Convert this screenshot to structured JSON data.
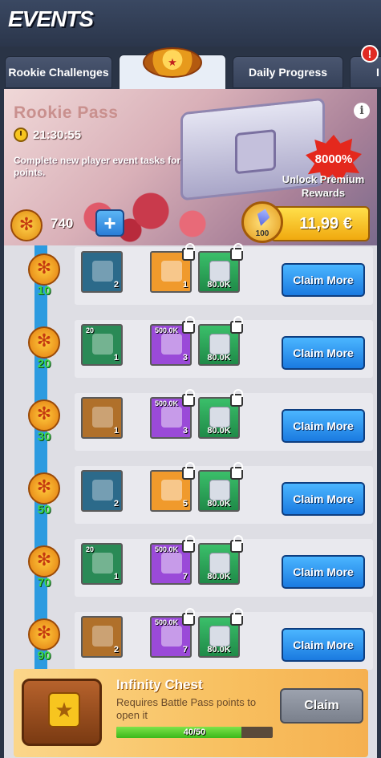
{
  "header": {
    "title": "EVENTS",
    "alert_badge": "!"
  },
  "tabs": [
    {
      "label": "Rookie Challenges",
      "active": false
    },
    {
      "label": "",
      "active": true,
      "logo": "event-logo-icon"
    },
    {
      "label": "Daily Progress",
      "active": false
    },
    {
      "label": "I",
      "active": false
    }
  ],
  "pass": {
    "title": "Rookie Pass",
    "timer": "21:30:55",
    "description": "Complete new player event tasks for points.",
    "info": "i",
    "bonus_badge": "8000%",
    "unlock_label": "Unlock Premium Rewards",
    "points": "740",
    "plus_label": "+",
    "gem_count": "100",
    "price": "11,99 €"
  },
  "rows": [
    {
      "level": "10",
      "free_item": {
        "color": "#2c6a8a",
        "qty": "2",
        "top": ""
      },
      "premium_item": {
        "color": "#f09a2c",
        "qty": "1",
        "top": ""
      },
      "xp_item": {
        "label": "80.0K"
      },
      "button": "Claim More"
    },
    {
      "level": "20",
      "free_item": {
        "color": "#2a8a56",
        "qty": "1",
        "top": "20"
      },
      "premium_item": {
        "color": "#9a4ad8",
        "qty": "3",
        "top": "500.0K"
      },
      "xp_item": {
        "label": "80.0K"
      },
      "button": "Claim More"
    },
    {
      "level": "30",
      "free_item": {
        "color": "#b0702a",
        "qty": "1",
        "top": ""
      },
      "premium_item": {
        "color": "#9a4ad8",
        "qty": "3",
        "top": "500.0K"
      },
      "xp_item": {
        "label": "80.0K"
      },
      "button": "Claim More"
    },
    {
      "level": "50",
      "free_item": {
        "color": "#2c6a8a",
        "qty": "2",
        "top": ""
      },
      "premium_item": {
        "color": "#f09a2c",
        "qty": "5",
        "top": ""
      },
      "xp_item": {
        "label": "80.0K"
      },
      "button": "Claim More"
    },
    {
      "level": "70",
      "free_item": {
        "color": "#2a8a56",
        "qty": "1",
        "top": "20"
      },
      "premium_item": {
        "color": "#9a4ad8",
        "qty": "7",
        "top": "500.0K"
      },
      "xp_item": {
        "label": "80.0K"
      },
      "button": "Claim More"
    },
    {
      "level": "90",
      "free_item": {
        "color": "#b0702a",
        "qty": "2",
        "top": ""
      },
      "premium_item": {
        "color": "#9a4ad8",
        "qty": "7",
        "top": "500.0K"
      },
      "xp_item": {
        "label": "80.0K"
      },
      "button": "Claim More"
    }
  ],
  "infinity_chest": {
    "title": "Infinity Chest",
    "description": "Requires Battle Pass points to open it",
    "progress_text": "40/50",
    "progress": 0.8,
    "button": "Claim"
  }
}
